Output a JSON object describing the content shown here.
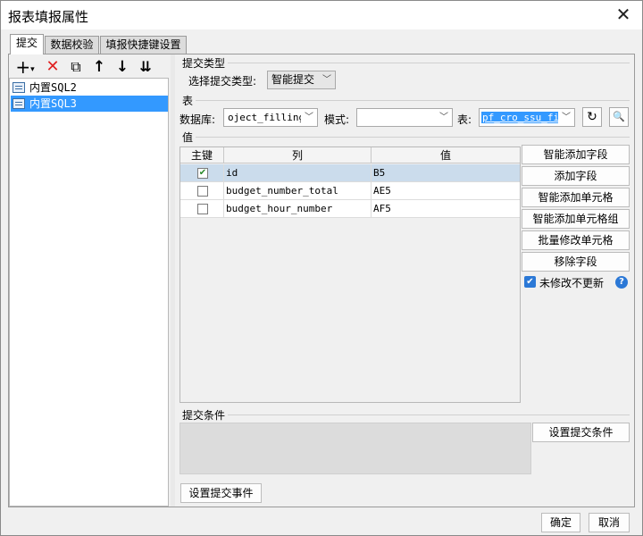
{
  "dialog": {
    "title": "报表填报属性",
    "close_symbol": "✕"
  },
  "tabs": [
    {
      "label": "提交",
      "active": true
    },
    {
      "label": "数据校验",
      "active": false
    },
    {
      "label": "填报快捷键设置",
      "active": false
    }
  ],
  "toolbar": {
    "icons": [
      "plus-dropdown-icon",
      "delete-icon",
      "copy-icon",
      "move-up-icon",
      "move-down-icon",
      "sort-icon"
    ],
    "plus_symbol": "+",
    "dropdown_symbol": "▾",
    "delete_symbol": "✕",
    "copy_symbol": "⧉",
    "up_symbol": "↑",
    "down_symbol": "↓",
    "sort_symbol": "⇊"
  },
  "tree": {
    "items": [
      {
        "label": "内置SQL2",
        "selected": false
      },
      {
        "label": "内置SQL3",
        "selected": true
      }
    ]
  },
  "submit_type": {
    "section_label": "提交类型",
    "field_label": "选择提交类型:",
    "value": "智能提交"
  },
  "table": {
    "section_label": "表",
    "db_label": "数据库:",
    "db_value": "oject_filling",
    "schema_label": "模式:",
    "schema_value": "",
    "table_label": "表:",
    "table_value": "pf_cro_ssu_fin",
    "refresh_symbol": "↻",
    "search_symbol": "🔍"
  },
  "values": {
    "section_label": "值",
    "columns": [
      "主键",
      "列",
      "值"
    ],
    "rows": [
      {
        "key": true,
        "column": "id",
        "value": "B5",
        "selected": true
      },
      {
        "key": false,
        "column": "budget_number_total",
        "value": "AE5",
        "selected": false
      },
      {
        "key": false,
        "column": "budget_hour_number",
        "value": "AF5",
        "selected": false
      }
    ],
    "check_symbol": "✔",
    "buttons": [
      "智能添加字段",
      "添加字段",
      "智能添加单元格",
      "智能添加单元格组",
      "批量修改单元格",
      "移除字段"
    ],
    "no_update_label": "未修改不更新",
    "no_update_checked": true,
    "help_symbol": "?"
  },
  "condition": {
    "section_label": "提交条件",
    "set_condition_label": "设置提交条件"
  },
  "events": {
    "set_event_label": "设置提交事件"
  },
  "footer": {
    "ok_label": "确定",
    "cancel_label": "取消"
  },
  "colors": {
    "selection_blue": "#3399ff",
    "row_selected": "#cbdcec",
    "checkbox_blue": "#2b78d6",
    "delete_red": "#e02020"
  }
}
